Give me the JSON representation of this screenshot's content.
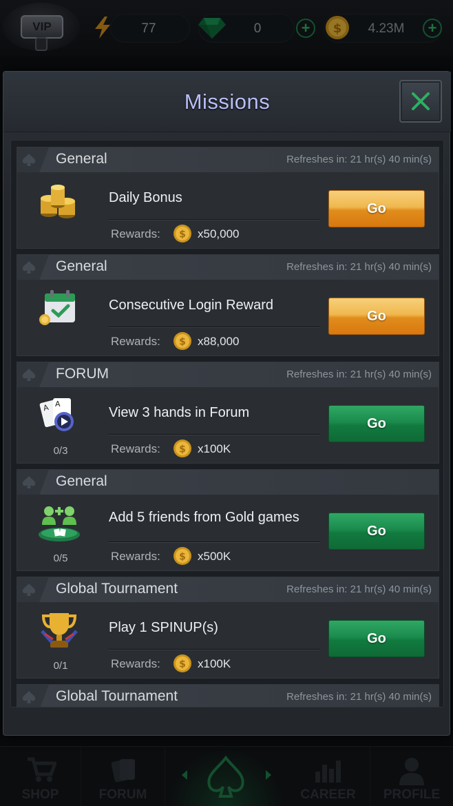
{
  "topbar": {
    "vip_label": "VIP",
    "energy": "77",
    "gems": "0",
    "coins": "4.23M"
  },
  "modal": {
    "title": "Missions"
  },
  "missions": [
    {
      "category": "General",
      "refresh": "Refreshes in: 21 hr(s) 40 min(s)",
      "title": "Daily Bonus",
      "progress": "",
      "rewards_label": "Rewards:",
      "reward": "x50,000",
      "button": "Go",
      "button_style": "gold",
      "icon": "coin-stack-icon"
    },
    {
      "category": "General",
      "refresh": "Refreshes in: 21 hr(s) 40 min(s)",
      "title": "Consecutive Login Reward",
      "progress": "",
      "rewards_label": "Rewards:",
      "reward": "x88,000",
      "button": "Go",
      "button_style": "gold",
      "icon": "calendar-check-icon"
    },
    {
      "category": "FORUM",
      "refresh": "Refreshes in: 21 hr(s) 40 min(s)",
      "title": "View 3 hands in Forum",
      "progress": "0/3",
      "rewards_label": "Rewards:",
      "reward": "x100K",
      "button": "Go",
      "button_style": "green",
      "icon": "cards-video-icon"
    },
    {
      "category": "General",
      "refresh": "",
      "title": "Add 5 friends from Gold games",
      "progress": "0/5",
      "rewards_label": "Rewards:",
      "reward": "x500K",
      "button": "Go",
      "button_style": "green",
      "icon": "add-friends-icon"
    },
    {
      "category": "Global Tournament",
      "refresh": "Refreshes in: 21 hr(s) 40 min(s)",
      "title": "Play 1 SPINUP(s)",
      "progress": "0/1",
      "rewards_label": "Rewards:",
      "reward": "x100K",
      "button": "Go",
      "button_style": "green",
      "icon": "trophy-icon"
    },
    {
      "category": "Global Tournament",
      "refresh": "Refreshes in: 21 hr(s) 40 min(s)"
    }
  ],
  "nav": [
    {
      "label": "SHOP",
      "icon": "cart-icon"
    },
    {
      "label": "FORUM",
      "icon": "forum-cards-icon"
    },
    {
      "label": "",
      "icon": "spade-icon"
    },
    {
      "label": "CAREER",
      "icon": "bar-chart-icon"
    },
    {
      "label": "PROFILE",
      "icon": "person-icon"
    }
  ],
  "colors": {
    "gold_button": "#e8a233",
    "green_button": "#1b8b4d",
    "title": "#b9bef8",
    "close_x": "#2fae64"
  }
}
